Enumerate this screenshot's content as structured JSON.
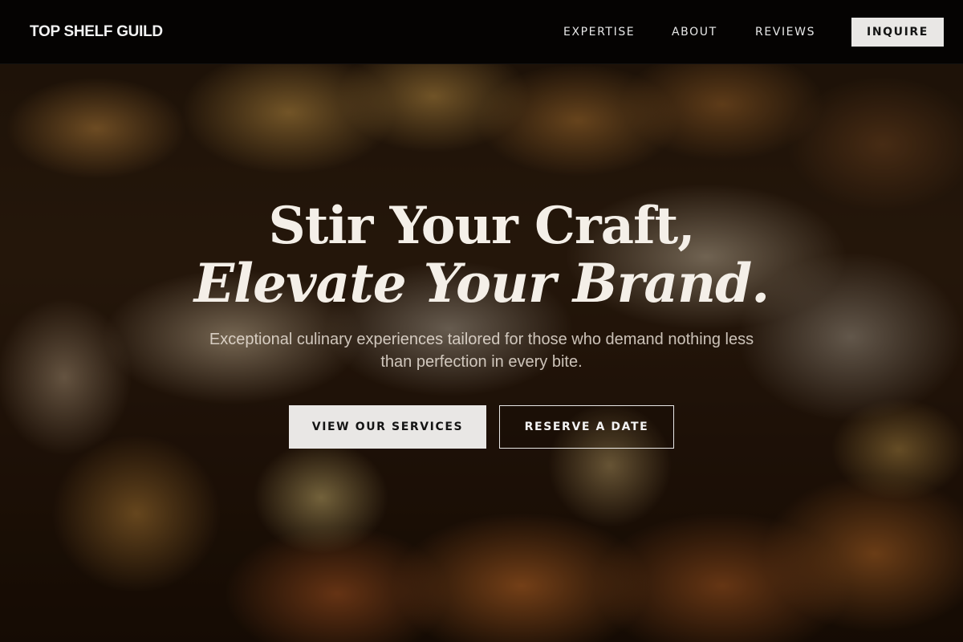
{
  "nav": {
    "brand": "TOP SHELF GUILD",
    "links": [
      {
        "label": "EXPERTISE"
      },
      {
        "label": "ABOUT"
      },
      {
        "label": "REVIEWS"
      }
    ],
    "cta_label": "INQUIRE"
  },
  "hero": {
    "title_line1": "Stir Your Craft,",
    "title_line2": "Elevate Your Brand.",
    "subtitle": "Exceptional culinary experiences tailored for those who demand nothing less than perfection in every bite.",
    "primary_button": "VIEW OUR SERVICES",
    "secondary_button": "RESERVE A DATE",
    "background_image": "food-platter-photo"
  },
  "colors": {
    "nav_background": "#050302",
    "button_light": "#e9e7e5",
    "text_light": "#f4efe8",
    "text_dark": "#141414"
  }
}
